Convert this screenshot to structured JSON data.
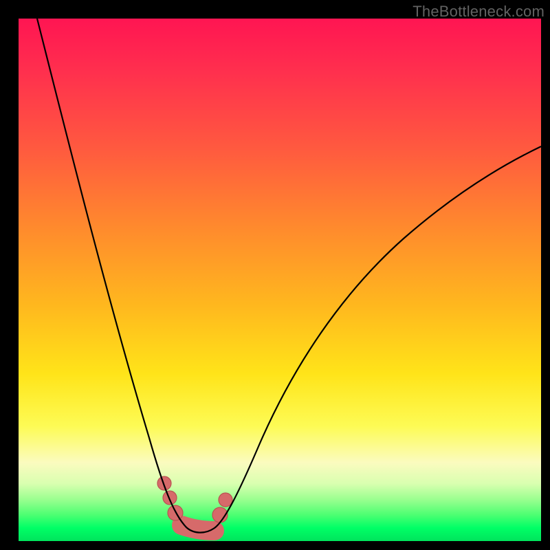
{
  "watermark": "TheBottleneck.com",
  "colors": {
    "frame": "#000000",
    "gradient_top": "#ff1552",
    "gradient_bottom": "#00e45c",
    "curve": "#000000",
    "marker": "#d66a6a"
  },
  "chart_data": {
    "type": "line",
    "title": "",
    "xlabel": "",
    "ylabel": "",
    "xlim": [
      0,
      100
    ],
    "ylim": [
      0,
      100
    ],
    "note": "Bottleneck-style curve: y is approximate percentage (0=bottom/green, 100=top/red). Valley (minimum/optimal zone) around x≈31–38.",
    "series": [
      {
        "name": "curve",
        "x": [
          3,
          6,
          10,
          14,
          18,
          22,
          26,
          28,
          30,
          32,
          34,
          36,
          38,
          40,
          44,
          50,
          58,
          68,
          80,
          92,
          100
        ],
        "y": [
          100,
          89,
          75,
          61,
          47,
          33,
          19,
          12,
          6,
          3,
          2,
          2,
          3,
          7,
          17,
          30,
          44,
          56,
          66,
          73,
          77
        ]
      }
    ],
    "markers": {
      "name": "highlighted-range",
      "x": [
        28,
        29.5,
        32,
        36,
        38.5,
        40
      ],
      "y": [
        11,
        8,
        3,
        3,
        6,
        9
      ]
    },
    "optimal_range_x": [
      31,
      38
    ]
  }
}
